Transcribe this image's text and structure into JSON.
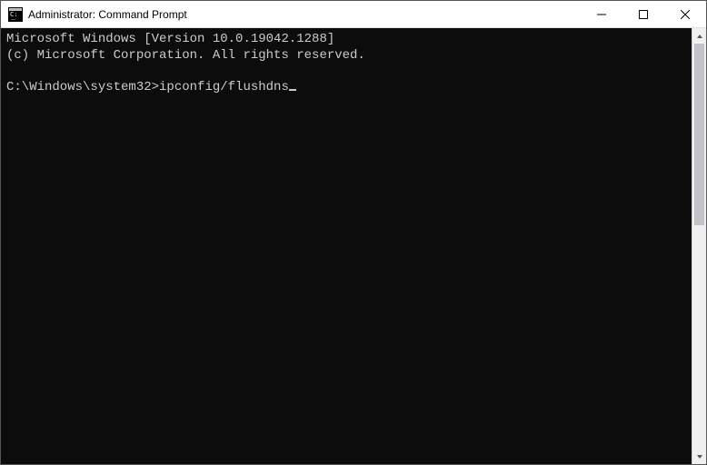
{
  "titlebar": {
    "title": "Administrator: Command Prompt"
  },
  "terminal": {
    "line1": "Microsoft Windows [Version 10.0.19042.1288]",
    "line2": "(c) Microsoft Corporation. All rights reserved.",
    "blank": "",
    "prompt": "C:\\Windows\\system32>",
    "command": "ipconfig/flushdns"
  }
}
